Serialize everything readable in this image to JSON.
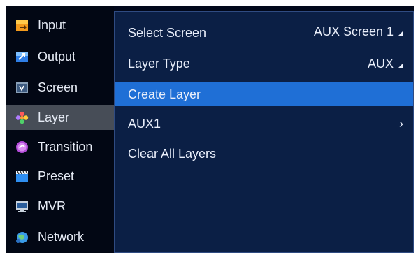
{
  "sidebar": {
    "items": [
      {
        "label": "Input",
        "icon": "input-icon"
      },
      {
        "label": "Output",
        "icon": "output-icon"
      },
      {
        "label": "Screen",
        "icon": "screen-icon"
      },
      {
        "label": "Layer",
        "icon": "layer-icon",
        "active": true
      },
      {
        "label": "Transition",
        "icon": "transition-icon"
      },
      {
        "label": "Preset",
        "icon": "preset-icon"
      },
      {
        "label": "MVR",
        "icon": "mvr-icon"
      },
      {
        "label": "Network",
        "icon": "network-icon"
      }
    ]
  },
  "main": {
    "rows": [
      {
        "label": "Select Screen",
        "value": "AUX Screen 1"
      },
      {
        "label": "Layer Type",
        "value": "AUX"
      },
      {
        "label": "Create Layer",
        "selected": true
      },
      {
        "label": "AUX1",
        "chevron": "›"
      },
      {
        "label": "Clear All Layers"
      }
    ]
  },
  "colors": {
    "background": "#02081a",
    "panel": "#0b1f45",
    "selected": "#1f6fd6",
    "active_sidebar": "#474d57",
    "text": "#e9eefa"
  }
}
